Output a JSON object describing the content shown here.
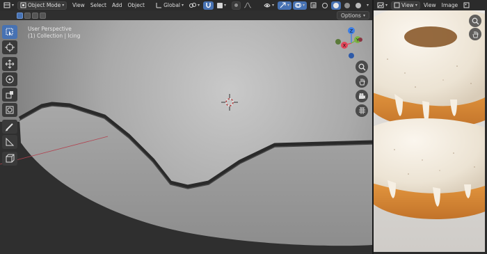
{
  "viewport": {
    "header": {
      "mode_label": "Object Mode",
      "menus": [
        "View",
        "Select",
        "Add",
        "Object"
      ],
      "orientation_label": "Global"
    },
    "options_label": "Options",
    "overlay": {
      "view_name": "User Perspective",
      "collection_info": "(1) Collection | Icing"
    },
    "gizmo": {
      "x": "X",
      "y": "Y",
      "z": "Z"
    }
  },
  "image_editor": {
    "menus": [
      "View",
      "View",
      "Image"
    ]
  },
  "colors": {
    "active_blue": "#4772b3",
    "gizmo_x": "#e2475a",
    "gizmo_y": "#7cb342",
    "gizmo_z": "#3d7fe6"
  },
  "icons": {
    "toolbar": [
      "select-box-icon",
      "cursor-icon",
      "move-icon",
      "rotate-icon",
      "scale-icon",
      "transform-icon",
      "annotate-icon",
      "measure-icon",
      "add-cube-icon"
    ],
    "nav": [
      "zoom-icon",
      "hand-pan-icon",
      "camera-icon",
      "grid-icon"
    ]
  }
}
